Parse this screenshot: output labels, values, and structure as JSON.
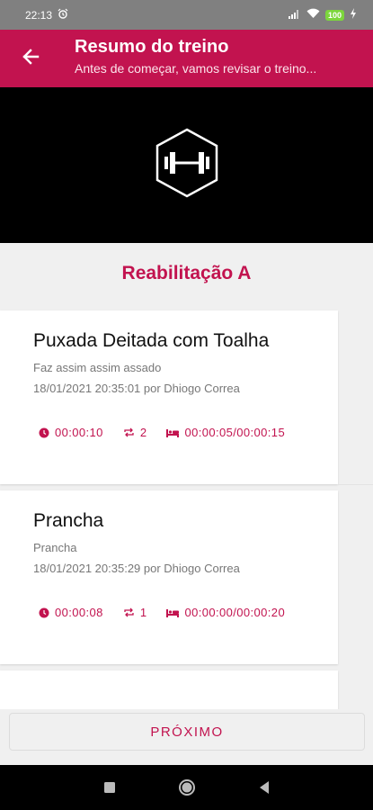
{
  "status_bar": {
    "time": "22:13",
    "battery": "100"
  },
  "app_bar": {
    "title": "Resumo do treino",
    "subtitle": "Antes de começar, vamos revisar o treino..."
  },
  "workout": {
    "name": "Reabilitação A"
  },
  "exercises": [
    {
      "name": "Puxada Deitada com Toalha",
      "description": "Faz assim assim assado",
      "meta": "18/01/2021 20:35:01 por Dhiogo Correa",
      "duration": "00:00:10",
      "repetitions": "2",
      "rest": "00:00:05/00:00:15"
    },
    {
      "name": "Prancha",
      "description": "Prancha",
      "meta": "18/01/2021 20:35:29 por Dhiogo Correa",
      "duration": "00:00:08",
      "repetitions": "1",
      "rest": "00:00:00/00:00:20"
    }
  ],
  "footer": {
    "next_label": "PRÓXIMO"
  },
  "colors": {
    "accent": "#c2134f",
    "hero_bg": "#000000",
    "status_bar": "#808080"
  },
  "icons": [
    "back-arrow-icon",
    "dumbbell-hexagon-icon",
    "clock-icon",
    "repeat-icon",
    "bed-icon",
    "recents-square-icon",
    "home-circle-icon",
    "back-triangle-icon"
  ]
}
